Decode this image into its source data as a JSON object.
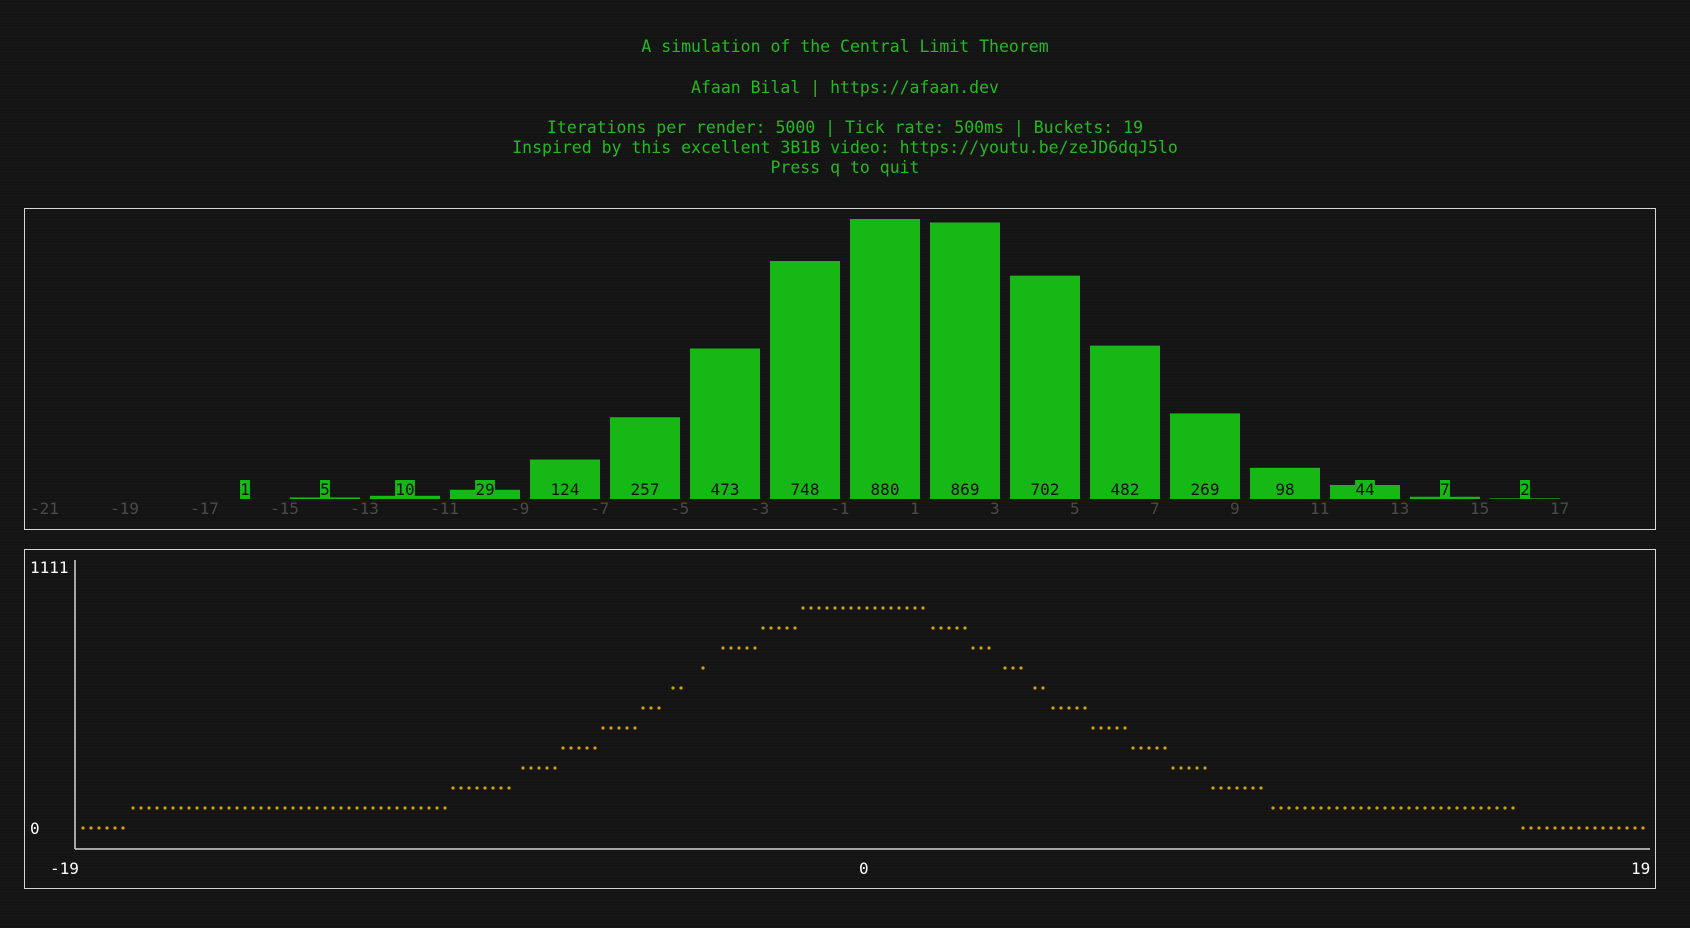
{
  "header": {
    "title": "A simulation of the Central Limit Theorem",
    "author": "Afaan Bilal | https://afaan.dev",
    "stats": "Iterations per render: 5000 | Tick rate: 500ms | Buckets: 19",
    "inspiration": "Inspired by this excellent 3B1B video: https://youtu.be/zeJD6dqJ5lo",
    "quit_hint": "Press q to quit"
  },
  "colors": {
    "bar": "#16b816",
    "text_green": "#25b822",
    "dot": "#d4a017",
    "border": "#d6d6d6",
    "tick": "#4a4a4a"
  },
  "chart_data": [
    {
      "type": "bar",
      "categories": [
        "-17",
        "-15",
        "-13",
        "-11",
        "-9",
        "-7",
        "-5",
        "-3",
        "-1",
        "1",
        "3",
        "5",
        "7",
        "9",
        "11",
        "13",
        "15"
      ],
      "values": [
        1,
        5,
        10,
        29,
        124,
        257,
        473,
        748,
        880,
        869,
        702,
        482,
        269,
        98,
        44,
        7,
        2
      ],
      "x_ticks": [
        "-21",
        "-19",
        "-17",
        "-15",
        "-13",
        "-11",
        "-9",
        "-7",
        "-5",
        "-3",
        "-1",
        "1",
        "3",
        "5",
        "7",
        "9",
        "11",
        "13",
        "15",
        "17"
      ],
      "ylim": [
        0,
        880
      ],
      "grid": false
    },
    {
      "type": "scatter",
      "xlim": [
        -19,
        19
      ],
      "ylim": [
        0,
        1111
      ],
      "x_ticks": [
        "-19",
        "0",
        "19"
      ],
      "y_ticks": [
        "0",
        "1111"
      ],
      "series_color": "dot",
      "grid": false
    }
  ]
}
